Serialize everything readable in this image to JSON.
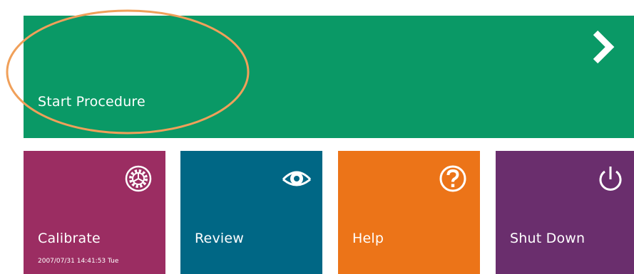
{
  "colors": {
    "start": "#0a9966",
    "calibrate": "#9b2d62",
    "review": "#006785",
    "help": "#ec7418",
    "shutdown": "#6a2e6d",
    "highlight": "#f0a05a"
  },
  "start_tile": {
    "label": "Start Procedure",
    "icon": "chevron-right-icon"
  },
  "tiles": [
    {
      "label": "Calibrate",
      "icon": "gear-icon",
      "timestamp": "2007/07/31 14:41:53 Tue"
    },
    {
      "label": "Review",
      "icon": "eye-icon"
    },
    {
      "label": "Help",
      "icon": "question-icon"
    },
    {
      "label": "Shut Down",
      "icon": "power-icon"
    }
  ]
}
